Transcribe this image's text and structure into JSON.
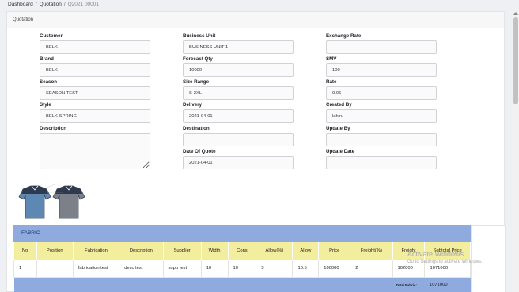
{
  "breadcrumb": {
    "home": "Dashboard",
    "section": "Quotation",
    "current": "Q2021 00001"
  },
  "card": {
    "title": "Quotation"
  },
  "form": {
    "customer": {
      "label": "Customer",
      "value": "BELK"
    },
    "brand": {
      "label": "Brand",
      "value": "BELK"
    },
    "season": {
      "label": "Season",
      "value": "SEASON TEST"
    },
    "style": {
      "label": "Style",
      "value": "BELK-SPRING"
    },
    "description": {
      "label": "Description",
      "value": ""
    },
    "business_unit": {
      "label": "Business Unit",
      "value": "BUSINESS UNIT 1"
    },
    "forecast_qty": {
      "label": "Forecast Qty",
      "value": "10000"
    },
    "size_range": {
      "label": "Size Range",
      "value": "S-2XL"
    },
    "delivery": {
      "label": "Delivery",
      "value": "2021-04-01"
    },
    "destination": {
      "label": "Destination",
      "value": ""
    },
    "date_of_quote": {
      "label": "Date Of Quote",
      "value": "2021-04-01"
    },
    "exchange_rate": {
      "label": "Exchange Rate",
      "value": ""
    },
    "smv": {
      "label": "SMV",
      "value": "100"
    },
    "rate": {
      "label": "Rate",
      "value": "0.06"
    },
    "created_by": {
      "label": "Created By",
      "value": "lahiru"
    },
    "update_by": {
      "label": "Update By",
      "value": ""
    },
    "update_date": {
      "label": "Update Date",
      "value": ""
    }
  },
  "fabric": {
    "title": "FABRIC",
    "columns": [
      "No",
      "Position",
      "Fabrication",
      "Description",
      "Supplier",
      "Width",
      "Cons",
      "Allow(%)",
      "Allow",
      "Price",
      "Freight(%)",
      "Freight",
      "Subtotal Price"
    ],
    "rows": [
      [
        "1",
        "",
        "fabrication test",
        "desc test",
        "supp test",
        "10",
        "10",
        "5",
        "10.5",
        "100000",
        "2",
        "102000",
        "1071000"
      ]
    ],
    "total_label": "Total Fabric:",
    "total_value": "1071000"
  },
  "colors": {
    "fabric_header": "#8eaadf",
    "columns_header": "#f3ed9e"
  },
  "watermark": {
    "line1": "Activate Windows",
    "line2": "Go to Settings to activate Windows."
  }
}
